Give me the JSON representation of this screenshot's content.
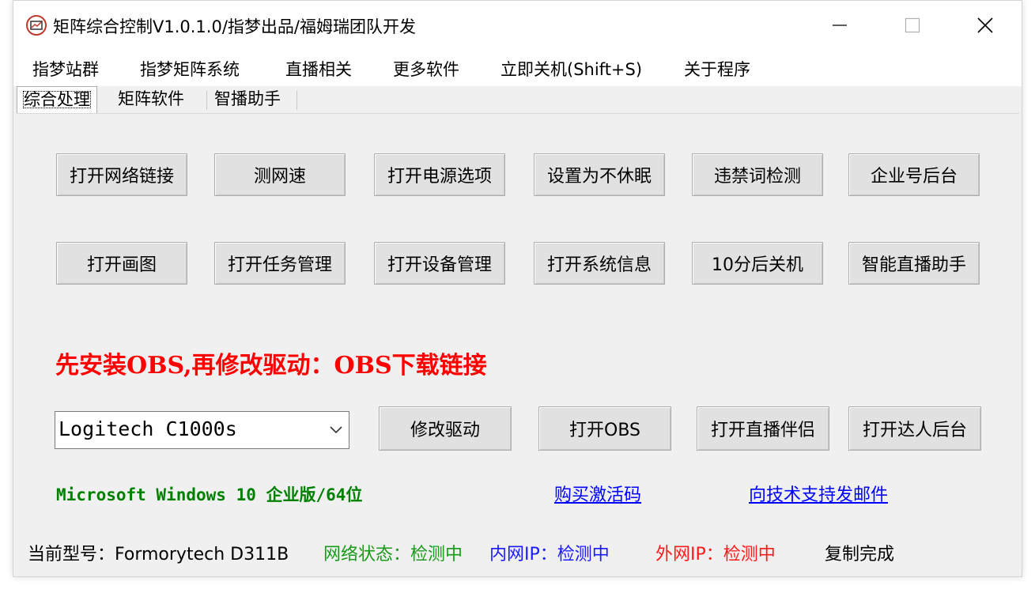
{
  "window": {
    "title": "矩阵综合控制V1.0.1.0/指梦出品/福姆瑞团队开发"
  },
  "menu": [
    "指梦站群",
    "指梦矩阵系统",
    "直播相关",
    "更多软件",
    "立即关机(Shift+S)",
    "关于程序"
  ],
  "tabs": [
    {
      "label": "综合处理",
      "active": true
    },
    {
      "label": "矩阵软件",
      "active": false
    },
    {
      "label": "智播助手",
      "active": false
    }
  ],
  "buttons_row1": [
    "打开网络链接",
    "测网速",
    "打开电源选项",
    "设置为不休眠",
    "违禁词检测",
    "企业号后台"
  ],
  "buttons_row2": [
    "打开画图",
    "打开任务管理",
    "打开设备管理",
    "打开系统信息",
    "10分后关机",
    "智能直播助手"
  ],
  "warning_text": "先安装OBS,再修改驱动：OBS下载链接",
  "camera_select": {
    "value": "Logitech C1000s"
  },
  "driver_buttons": [
    "修改驱动",
    "打开OBS",
    "打开直播伴侣",
    "打开达人后台"
  ],
  "os_info": "Microsoft Windows 10 企业版/64位",
  "links": {
    "buy_code": "购买激活码",
    "email_support": "向技术支持发邮件"
  },
  "status": {
    "model": "当前型号：Formorytech  D311B",
    "network": "网络状态：检测中",
    "lan_ip": "内网IP：检测中",
    "wan_ip": "外网IP：检测中",
    "copy": "复制完成"
  },
  "colors": {
    "warning": "#ff0000",
    "os_info": "#008000",
    "link": "#0000ff",
    "network_status": "#1a9a1a",
    "lan_ip": "#1a1aff",
    "wan_ip": "#ff1a1a"
  }
}
